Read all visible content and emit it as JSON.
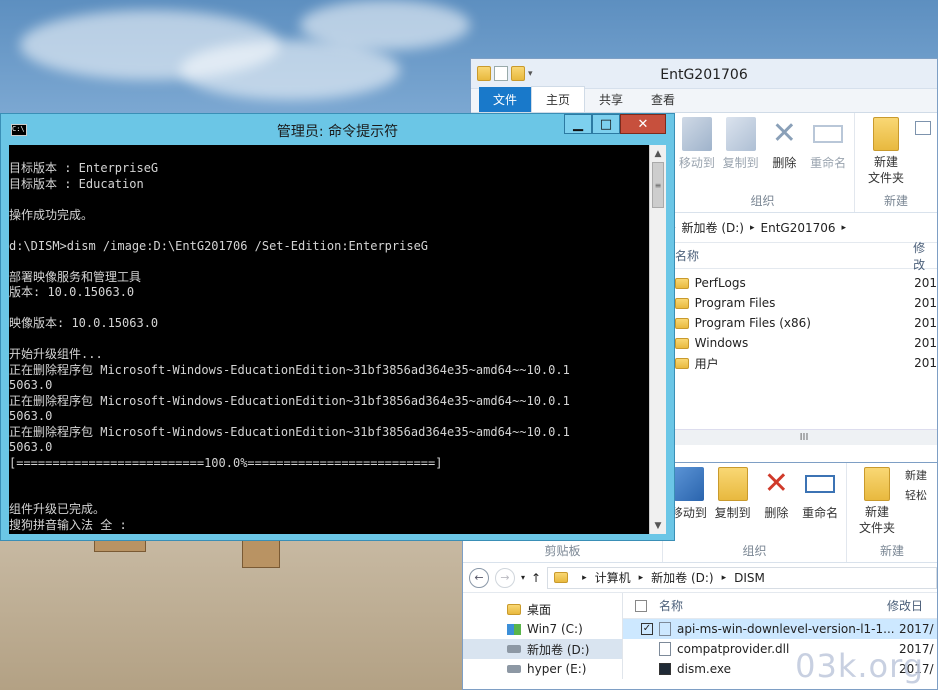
{
  "cmd": {
    "title": "管理员: 命令提示符",
    "icon": "C:\\",
    "buttons": {
      "minimize": "▁",
      "maximize": "□",
      "close": "✕"
    },
    "lines": [
      "目标版本 : EnterpriseG",
      "目标版本 : Education",
      "",
      "操作成功完成。",
      "",
      "d:\\DISM>dism /image:D:\\EntG201706 /Set-Edition:EnterpriseG",
      "",
      "部署映像服务和管理工具",
      "版本: 10.0.15063.0",
      "",
      "映像版本: 10.0.15063.0",
      "",
      "开始升级组件...",
      "正在删除程序包 Microsoft-Windows-EducationEdition~31bf3856ad364e35~amd64~~10.0.1",
      "5063.0",
      "正在删除程序包 Microsoft-Windows-EducationEdition~31bf3856ad364e35~amd64~~10.0.1",
      "5063.0",
      "正在删除程序包 Microsoft-Windows-EducationEdition~31bf3856ad364e35~amd64~~10.0.1",
      "5063.0",
      "[==========================100.0%==========================]",
      "",
      "",
      "组件升级已完成。",
      "搜狗拼音输入法 全 :"
    ]
  },
  "explorer_top": {
    "title": "EntG201706",
    "tabs": [
      "文件",
      "主页",
      "共享",
      "查看"
    ],
    "ribbon": {
      "organize": {
        "label": "组织",
        "buttons": [
          "移动到",
          "复制到",
          "删除",
          "重命名"
        ]
      },
      "new": {
        "label": "新建",
        "buttons": [
          "新建\n文件夹"
        ]
      }
    },
    "breadcrumb": [
      "新加卷 (D:)",
      "EntG201706"
    ],
    "columns": [
      "名称",
      "修改"
    ],
    "rows": [
      {
        "name": "PerfLogs",
        "date": "201"
      },
      {
        "name": "Program Files",
        "date": "201"
      },
      {
        "name": "Program Files (x86)",
        "date": "201"
      },
      {
        "name": "Windows",
        "date": "201"
      },
      {
        "name": "用户",
        "date": "201"
      }
    ],
    "scroll_grip": "III"
  },
  "explorer_bottom": {
    "ribbon": {
      "clipboard": {
        "label": "剪贴板"
      },
      "organize": {
        "label": "组织",
        "buttons": [
          "移动到",
          "复制到",
          "删除",
          "重命名"
        ]
      },
      "new": {
        "label": "新建",
        "buttons": [
          "新建\n文件夹",
          "新建",
          "轻松"
        ]
      }
    },
    "breadcrumb": [
      "计算机",
      "新加卷 (D:)",
      "DISM"
    ],
    "nav_tree": [
      "桌面",
      "Win7 (C:)",
      "新加卷 (D:)",
      "hyper (E:)"
    ],
    "columns": [
      "名称",
      "修改日"
    ],
    "files": [
      {
        "name": "api-ms-win-downlevel-version-l1-1...",
        "date": "2017/",
        "checked": true
      },
      {
        "name": "compatprovider.dll",
        "date": "2017/"
      },
      {
        "name": "dism.exe",
        "date": "2017/"
      }
    ]
  },
  "watermark": "03k.org"
}
